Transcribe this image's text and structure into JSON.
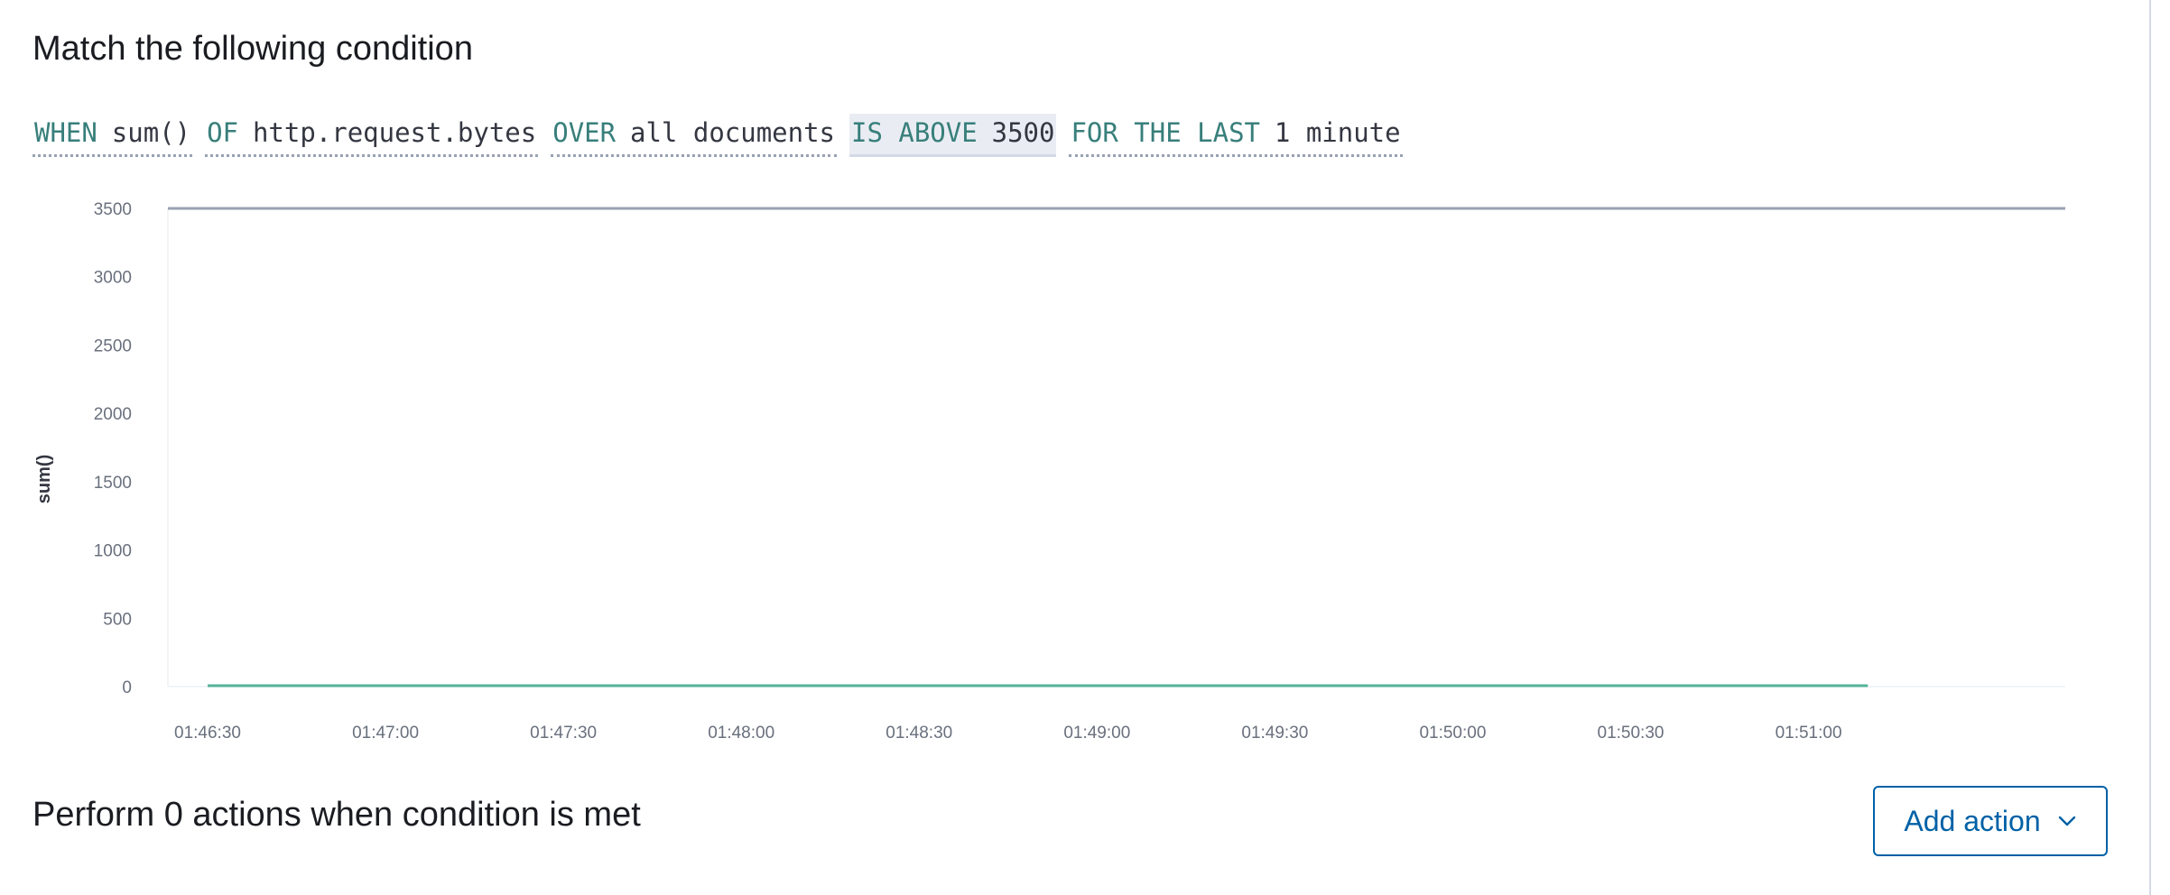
{
  "condition_section": {
    "title": "Match the following condition"
  },
  "expression": {
    "when": {
      "keyword": "WHEN",
      "value": "sum()"
    },
    "of": {
      "keyword": "OF",
      "value": "http.request.bytes"
    },
    "over": {
      "keyword": "OVER",
      "value": "all documents"
    },
    "threshold": {
      "keyword": "IS ABOVE",
      "value": "3500"
    },
    "for_the_last": {
      "keyword": "FOR THE LAST",
      "value": "1 minute"
    }
  },
  "chart_data": {
    "type": "line",
    "title": "",
    "xlabel": "",
    "ylabel": "sum()",
    "ylim": [
      0,
      3500
    ],
    "yticks": [
      0,
      500,
      1000,
      1500,
      2000,
      2500,
      3000,
      3500
    ],
    "x_tick_labels": [
      "01:46:30",
      "01:47:00",
      "01:47:30",
      "01:48:00",
      "01:48:30",
      "01:49:00",
      "01:49:30",
      "01:50:00",
      "01:50:30",
      "01:51:00"
    ],
    "x_range": [
      "01:46:30",
      "01:51:50"
    ],
    "grid": false,
    "series": [
      {
        "color": "#54b399",
        "x": [
          "01:46:30",
          "01:51:10"
        ],
        "values": [
          0,
          0
        ]
      }
    ],
    "threshold": {
      "value": 3500,
      "color": "#98a2b3"
    }
  },
  "actions_section": {
    "title": "Perform 0 actions when condition is met",
    "add_action_label": "Add action",
    "add_action_icon": "chevron-down-icon"
  }
}
